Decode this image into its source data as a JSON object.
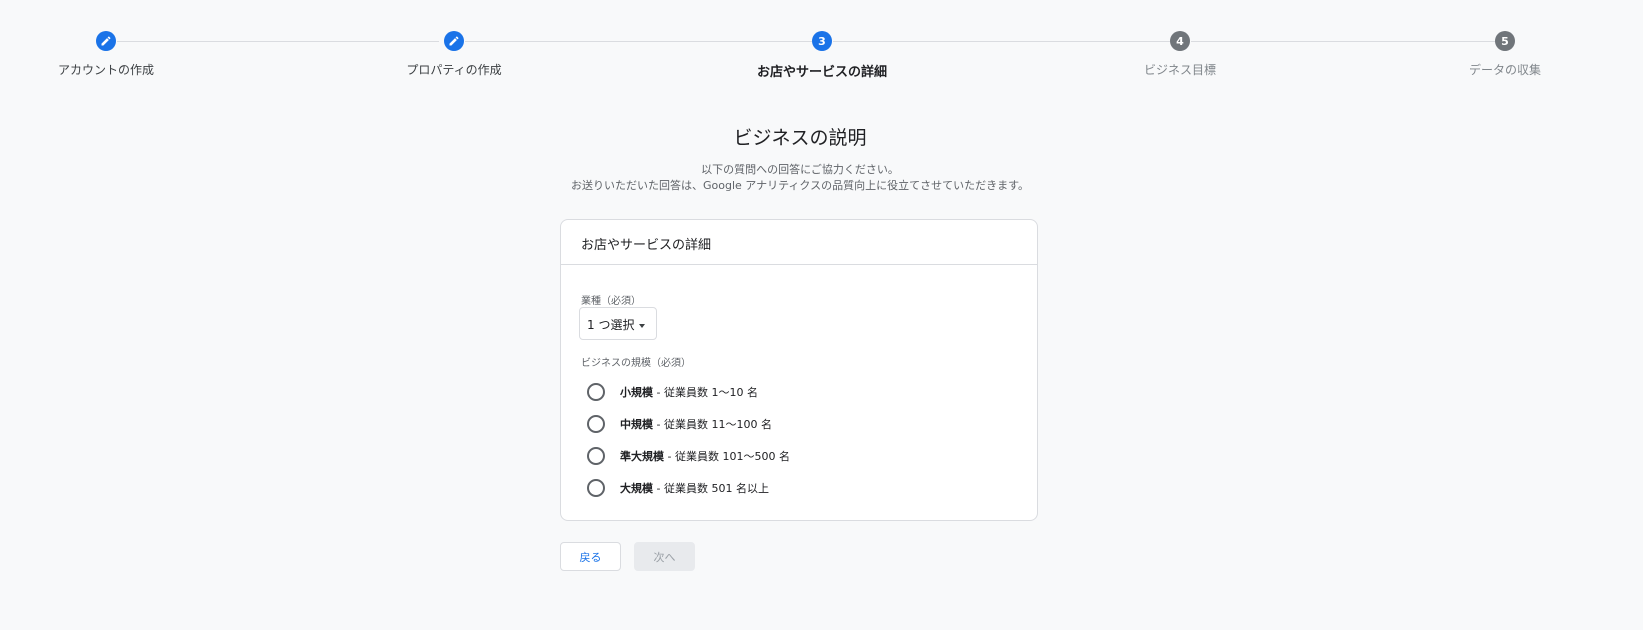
{
  "stepper": {
    "steps": [
      {
        "label": "アカウントの作成",
        "state": "done",
        "icon": "pencil-icon"
      },
      {
        "label": "プロパティの作成",
        "state": "done",
        "icon": "pencil-icon"
      },
      {
        "label": "お店やサービスの詳細",
        "state": "active",
        "number": "3"
      },
      {
        "label": "ビジネス目標",
        "state": "todo",
        "number": "4"
      },
      {
        "label": "データの収集",
        "state": "todo",
        "number": "5"
      }
    ]
  },
  "page": {
    "title": "ビジネスの説明",
    "subtitle_line1": "以下の質問への回答にご協力ください。",
    "subtitle_line2": "お送りいただいた回答は、Google アナリティクスの品質向上に役立てさせていただきます。"
  },
  "card": {
    "header": "お店やサービスの詳細",
    "industry": {
      "label": "業種（必須）",
      "selected": "1 つ選択"
    },
    "size": {
      "label": "ビジネスの規模（必須）",
      "options": [
        {
          "bold": "小規模",
          "rest": " - 従業員数 1〜10 名"
        },
        {
          "bold": "中規模",
          "rest": " - 従業員数 11〜100 名"
        },
        {
          "bold": "準大規模",
          "rest": " - 従業員数 101〜500 名"
        },
        {
          "bold": "大規模",
          "rest": " - 従業員数 501 名以上"
        }
      ]
    }
  },
  "actions": {
    "back_label": "戻る",
    "next_label": "次へ"
  },
  "colors": {
    "accent": "#1a73e8",
    "inactive_step": "#70757a",
    "disabled_button_bg": "#e8eaed"
  }
}
